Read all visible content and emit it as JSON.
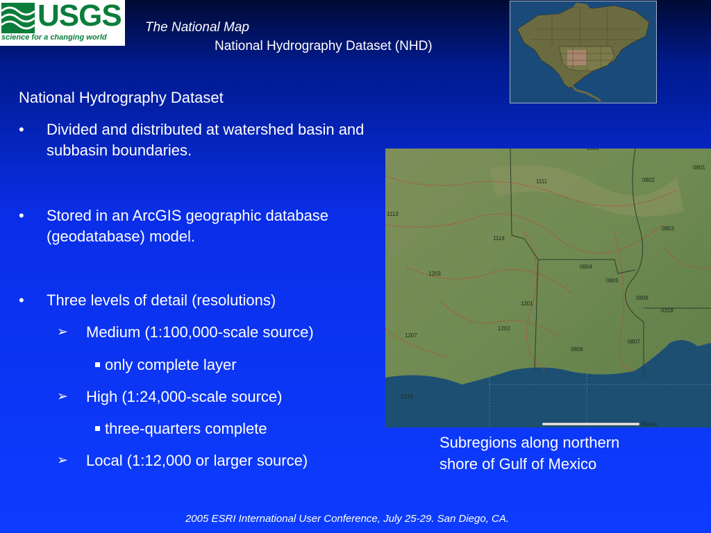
{
  "logo": {
    "wordmark": "USGS",
    "tagline": "science for a changing world"
  },
  "header": {
    "title": "The National Map",
    "subtitle": "National Hydrography Dataset (NHD)"
  },
  "content": {
    "heading": "National Hydrography Dataset",
    "bullets": [
      "Divided and distributed at watershed basin and subbasin boundaries.",
      "Stored in an ArcGIS geographic database (geodatabase) model.",
      "Three levels of detail (resolutions)"
    ],
    "levels": [
      {
        "label": "Medium (1:100,000-scale source)",
        "note": "only complete layer"
      },
      {
        "label": "High (1:24,000-scale source)",
        "note": "three-quarters complete"
      },
      {
        "label": "Local (1:12,000 or larger source)"
      }
    ]
  },
  "map": {
    "subregion_labels": [
      "1001",
      "1111",
      "0802",
      "0801",
      "1114",
      "0803",
      "0804",
      "0805",
      "1203",
      "0806",
      "0318",
      "1201",
      "1202",
      "0807",
      "1207",
      "0808",
      "1210",
      "1113"
    ],
    "scale_text": "250km",
    "caption": "Subregions along northern shore of Gulf of Mexico"
  },
  "footer": "2005 ESRI International User Conference, July 25-29.  San Diego, CA.",
  "colors": {
    "background": "#0d3cff",
    "usgs_green": "#0a7d3b",
    "boundary": "#b34a3a",
    "water": "#1a4a7a"
  }
}
